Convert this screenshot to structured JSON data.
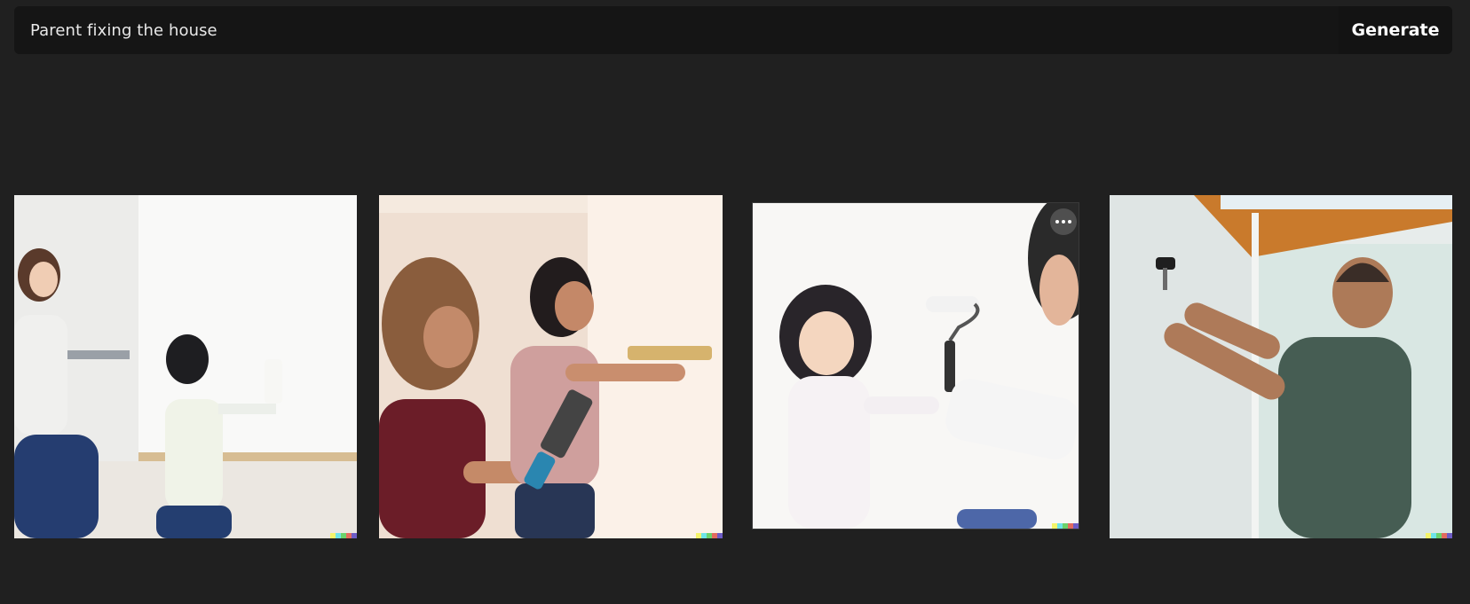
{
  "prompt": {
    "value": "Parent fixing the house",
    "generate_label": "Generate"
  },
  "results": [
    {
      "icon": "photo",
      "description": "mother and daughter painting wall"
    },
    {
      "icon": "photo",
      "description": "two women measuring wall"
    },
    {
      "icon": "photo",
      "description": "girl with paint roller"
    },
    {
      "icon": "photo",
      "description": "man hanging hook on wall"
    }
  ],
  "colors": {
    "background": "#202020",
    "prompt_bar": "#151515",
    "watermark": [
      "#f5f46a",
      "#6ee4e8",
      "#6bd26b",
      "#e36b5f",
      "#6d5cc6"
    ]
  }
}
